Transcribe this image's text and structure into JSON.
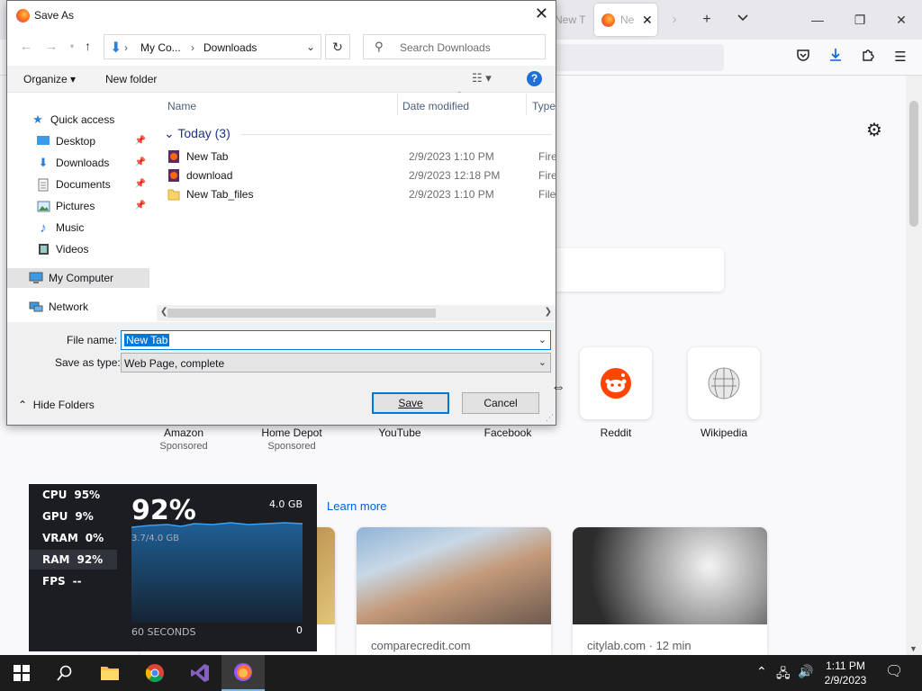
{
  "browser": {
    "bg_tab_label": "New T",
    "active_tab_label": "Ne",
    "close_tab_glyph": "✕",
    "new_tab_glyph": "+",
    "tab_list_glyph": "⌵"
  },
  "topsites": [
    {
      "label": "Amazon",
      "sub": "Sponsored"
    },
    {
      "label": "Home Depot",
      "sub": "Sponsored"
    },
    {
      "label": "YouTube",
      "sub": ""
    },
    {
      "label": "Facebook",
      "sub": ""
    },
    {
      "label": "Reddit",
      "sub": ""
    },
    {
      "label": "Wikipedia",
      "sub": ""
    }
  ],
  "pocket": {
    "learn_more": "Learn more",
    "cards": [
      {
        "source": "comparecredit.com"
      },
      {
        "source": "citylab.com · 12 min"
      }
    ]
  },
  "perf": {
    "stats": [
      {
        "name": "CPU",
        "value": "95%"
      },
      {
        "name": "GPU",
        "value": "9%"
      },
      {
        "name": "VRAM",
        "value": "0%"
      },
      {
        "name": "RAM",
        "value": "92%"
      },
      {
        "name": "FPS",
        "value": "--"
      }
    ],
    "big_value": "92%",
    "max_label": "4.0 GB",
    "used_label": "3.7/4.0 GB",
    "seconds_label": "60 SECONDS",
    "zero_label": "0"
  },
  "dialog": {
    "title": "Save As",
    "breadcrumb": [
      "My Co...",
      "Downloads"
    ],
    "search_placeholder": "Search Downloads",
    "organize_label": "Organize ▾",
    "new_folder_label": "New folder",
    "nav": {
      "quick_access": "Quick access",
      "items": [
        "Desktop",
        "Downloads",
        "Documents",
        "Pictures",
        "Music",
        "Videos"
      ],
      "my_computer": "My Computer",
      "network": "Network"
    },
    "columns": {
      "name": "Name",
      "date": "Date modified",
      "type": "Type"
    },
    "group_label": "Today (3)",
    "files": [
      {
        "name": "New Tab",
        "date": "2/9/2023 1:10 PM",
        "type": "Firefox"
      },
      {
        "name": "download",
        "date": "2/9/2023 12:18 PM",
        "type": "Firefox"
      },
      {
        "name": "New Tab_files",
        "date": "2/9/2023 1:10 PM",
        "type": "File folder"
      }
    ],
    "file_name_label": "File name:",
    "file_name_value": "New Tab",
    "save_type_label": "Save as type:",
    "save_type_value": "Web Page, complete",
    "hide_folders_label": "Hide Folders",
    "save_label": "Save",
    "cancel_label": "Cancel"
  },
  "taskbar": {
    "time": "1:11 PM",
    "date": "2/9/2023"
  }
}
